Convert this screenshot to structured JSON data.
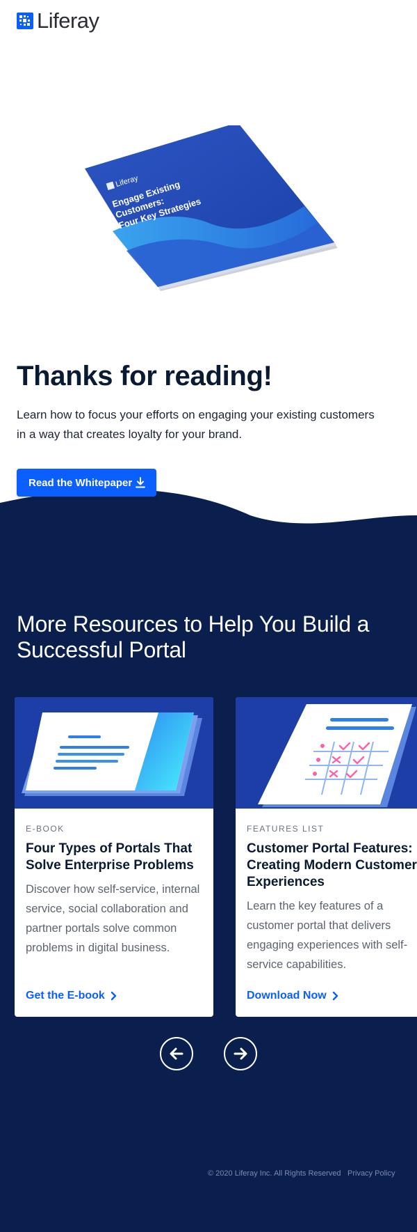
{
  "brand": {
    "name": "Liferay"
  },
  "book": {
    "logo_text": "Liferay",
    "title_lines": [
      "Engage Existing",
      "Customers:",
      "Four Key Strategies"
    ]
  },
  "hero": {
    "title": "Thanks for reading!",
    "description": "Learn how to focus your efforts on engaging your existing customers in a way that creates loyalty for your brand.",
    "cta_label": "Read the Whitepaper",
    "cta_icon": "download-icon"
  },
  "resources": {
    "heading": "More Resources to Help You Build a Successful Portal",
    "cards": [
      {
        "category": "E-BOOK",
        "title": "Four Types of Portals That Solve Enterprise Problems",
        "description": "Discover how self-service, internal service, social collaboration and partner portals solve common problems in digital business.",
        "link_label": "Get the E-book"
      },
      {
        "category": "FEATURES LIST",
        "title": "Customer Portal Features: Creating Modern Customer Experiences",
        "description": "Learn the key features of a customer portal that delivers engaging experiences with self-service capabilities.",
        "link_label": "Download Now"
      }
    ],
    "prev_icon": "arrow-left-icon",
    "next_icon": "arrow-right-icon"
  },
  "footer": {
    "copyright": "© 2020 Liferay Inc. All Rights Reserved",
    "privacy": "Privacy Policy"
  },
  "colors": {
    "accent": "#0b5fff",
    "dark_bg": "#0a1f4d",
    "card_image_bg": "#1c3ea6"
  }
}
